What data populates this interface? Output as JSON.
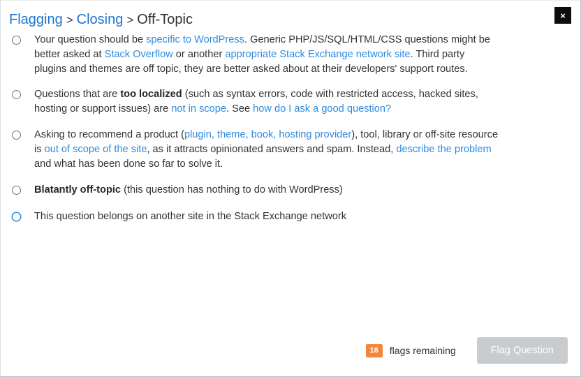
{
  "dialog": {
    "close_label": "×",
    "close_icon": "close-icon"
  },
  "breadcrumb": {
    "items": [
      {
        "label": "Flagging",
        "is_link": true
      },
      {
        "label": "Closing",
        "is_link": true
      },
      {
        "label": "Off-Topic",
        "is_link": false
      }
    ],
    "separator": ">"
  },
  "options": [
    {
      "id": "specific-to-wordpress",
      "selected": false,
      "hovered": false,
      "parts": [
        {
          "text": "Your question should be ",
          "type": "text"
        },
        {
          "text": "specific to WordPress",
          "type": "link"
        },
        {
          "text": ". Generic PHP/JS/SQL/HTML/CSS questions might be better asked at ",
          "type": "text"
        },
        {
          "text": "Stack Overflow",
          "type": "link"
        },
        {
          "text": " or another ",
          "type": "text"
        },
        {
          "text": "appropriate Stack Exchange network site",
          "type": "link"
        },
        {
          "text": ". Third party plugins and themes are off topic, they are better asked about at their developers' support routes.",
          "type": "text"
        }
      ]
    },
    {
      "id": "too-localized",
      "selected": false,
      "hovered": false,
      "parts": [
        {
          "text": "Questions that are ",
          "type": "text"
        },
        {
          "text": "too localized",
          "type": "bold"
        },
        {
          "text": " (such as syntax errors, code with restricted access, hacked sites, hosting or support issues) are ",
          "type": "text"
        },
        {
          "text": "not in scope",
          "type": "link"
        },
        {
          "text": ". See ",
          "type": "text"
        },
        {
          "text": "how do I ask a good question?",
          "type": "link"
        }
      ]
    },
    {
      "id": "product-recommendation",
      "selected": false,
      "hovered": false,
      "parts": [
        {
          "text": "Asking to recommend a product (",
          "type": "text"
        },
        {
          "text": "plugin, theme, book, hosting provider",
          "type": "link"
        },
        {
          "text": "), tool, library or off-site resource is ",
          "type": "text"
        },
        {
          "text": "out of scope of the site",
          "type": "link"
        },
        {
          "text": ", as it attracts opinionated answers and spam. Instead, ",
          "type": "text"
        },
        {
          "text": "describe the problem",
          "type": "link"
        },
        {
          "text": " and what has been done so far to solve it.",
          "type": "text"
        }
      ]
    },
    {
      "id": "blatantly-off-topic",
      "selected": false,
      "hovered": false,
      "parts": [
        {
          "text": "Blatantly off-topic",
          "type": "bold"
        },
        {
          "text": " (this question has nothing to do with WordPress)",
          "type": "text"
        }
      ]
    },
    {
      "id": "belongs-on-another-site",
      "selected": false,
      "hovered": true,
      "parts": [
        {
          "text": "This question belongs on another site in the Stack Exchange network",
          "type": "text"
        }
      ]
    }
  ],
  "footer": {
    "flags_count": "18",
    "flags_label": "flags remaining",
    "flag_button_label": "Flag Question",
    "flag_button_disabled": true
  },
  "colors": {
    "link": "#2d8ae0",
    "breadcrumb_link": "#1b75d0",
    "badge_bg": "#f4863a",
    "button_disabled_bg": "#c8ccce",
    "text": "#2f3337",
    "radio_hover": "#2d8ae0"
  }
}
